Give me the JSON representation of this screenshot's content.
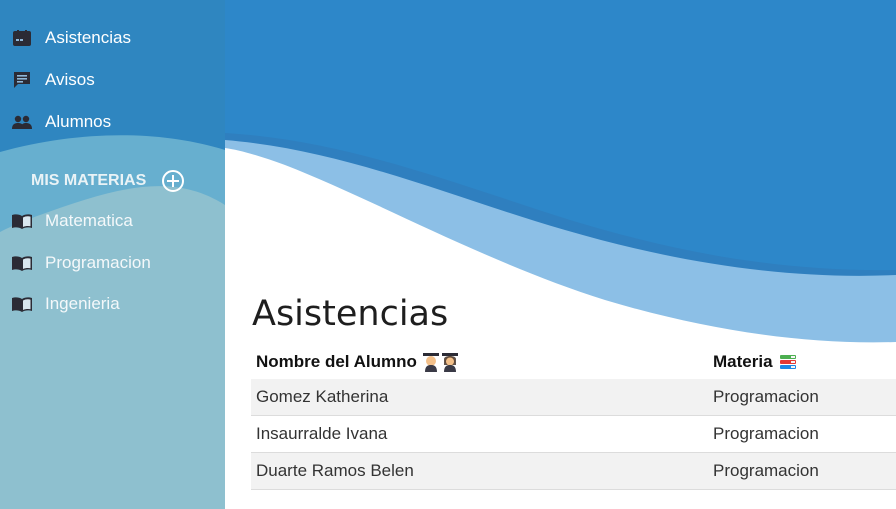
{
  "sidebar": {
    "nav": [
      {
        "label": "Asistencias",
        "icon": "calendar-icon"
      },
      {
        "label": "Avisos",
        "icon": "chat-icon"
      },
      {
        "label": "Alumnos",
        "icon": "people-icon"
      }
    ],
    "section_title": "MIS MATERIAS",
    "materias": [
      {
        "label": "Matematica",
        "icon": "book-icon"
      },
      {
        "label": "Programacion",
        "icon": "book-icon"
      },
      {
        "label": "Ingenieria",
        "icon": "book-icon"
      }
    ]
  },
  "main": {
    "title": "Asistencias",
    "table": {
      "headers": [
        "Nombre del Alumno",
        "Materia"
      ],
      "header_icons": [
        "student-emoji-icons",
        "books-emoji-icon"
      ],
      "rows": [
        [
          "Gomez Katherina",
          "Programacion"
        ],
        [
          "Insaurralde Ivana",
          "Programacion"
        ],
        [
          "Duarte Ramos Belen",
          "Programacion"
        ]
      ]
    }
  },
  "colors": {
    "sidebar_bg": "#8ec0cf",
    "primary_blue": "#2f86c8",
    "light_blue": "#8cc2e6"
  }
}
